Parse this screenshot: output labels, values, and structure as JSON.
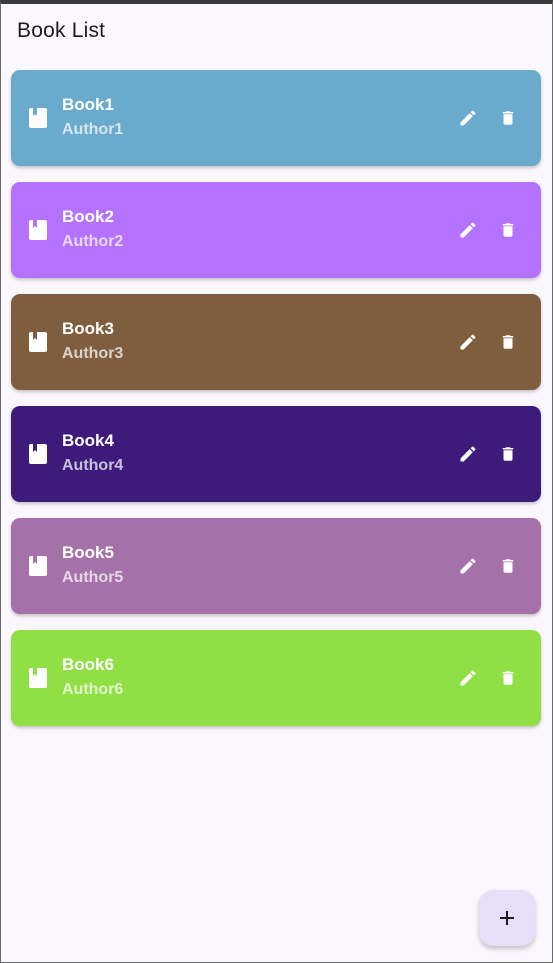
{
  "app_bar": {
    "title": "Book List"
  },
  "books": [
    {
      "title": "Book1",
      "author": "Author1",
      "color": "#6aaacc"
    },
    {
      "title": "Book2",
      "author": "Author2",
      "color": "#b572fe"
    },
    {
      "title": "Book3",
      "author": "Author3",
      "color": "#7f5e3f"
    },
    {
      "title": "Book4",
      "author": "Author4",
      "color": "#3d1b7a"
    },
    {
      "title": "Book5",
      "author": "Author5",
      "color": "#a571a9"
    },
    {
      "title": "Book6",
      "author": "Author6",
      "color": "#90e045"
    }
  ],
  "icons": {
    "book": "book-icon",
    "edit": "pencil-icon",
    "delete": "trash-icon",
    "add": "plus-icon"
  },
  "colors": {
    "background": "#fbf7fe",
    "fab_background": "#e7def8",
    "fab_icon": "#1d1b20",
    "title_text": "#1d1b20"
  }
}
